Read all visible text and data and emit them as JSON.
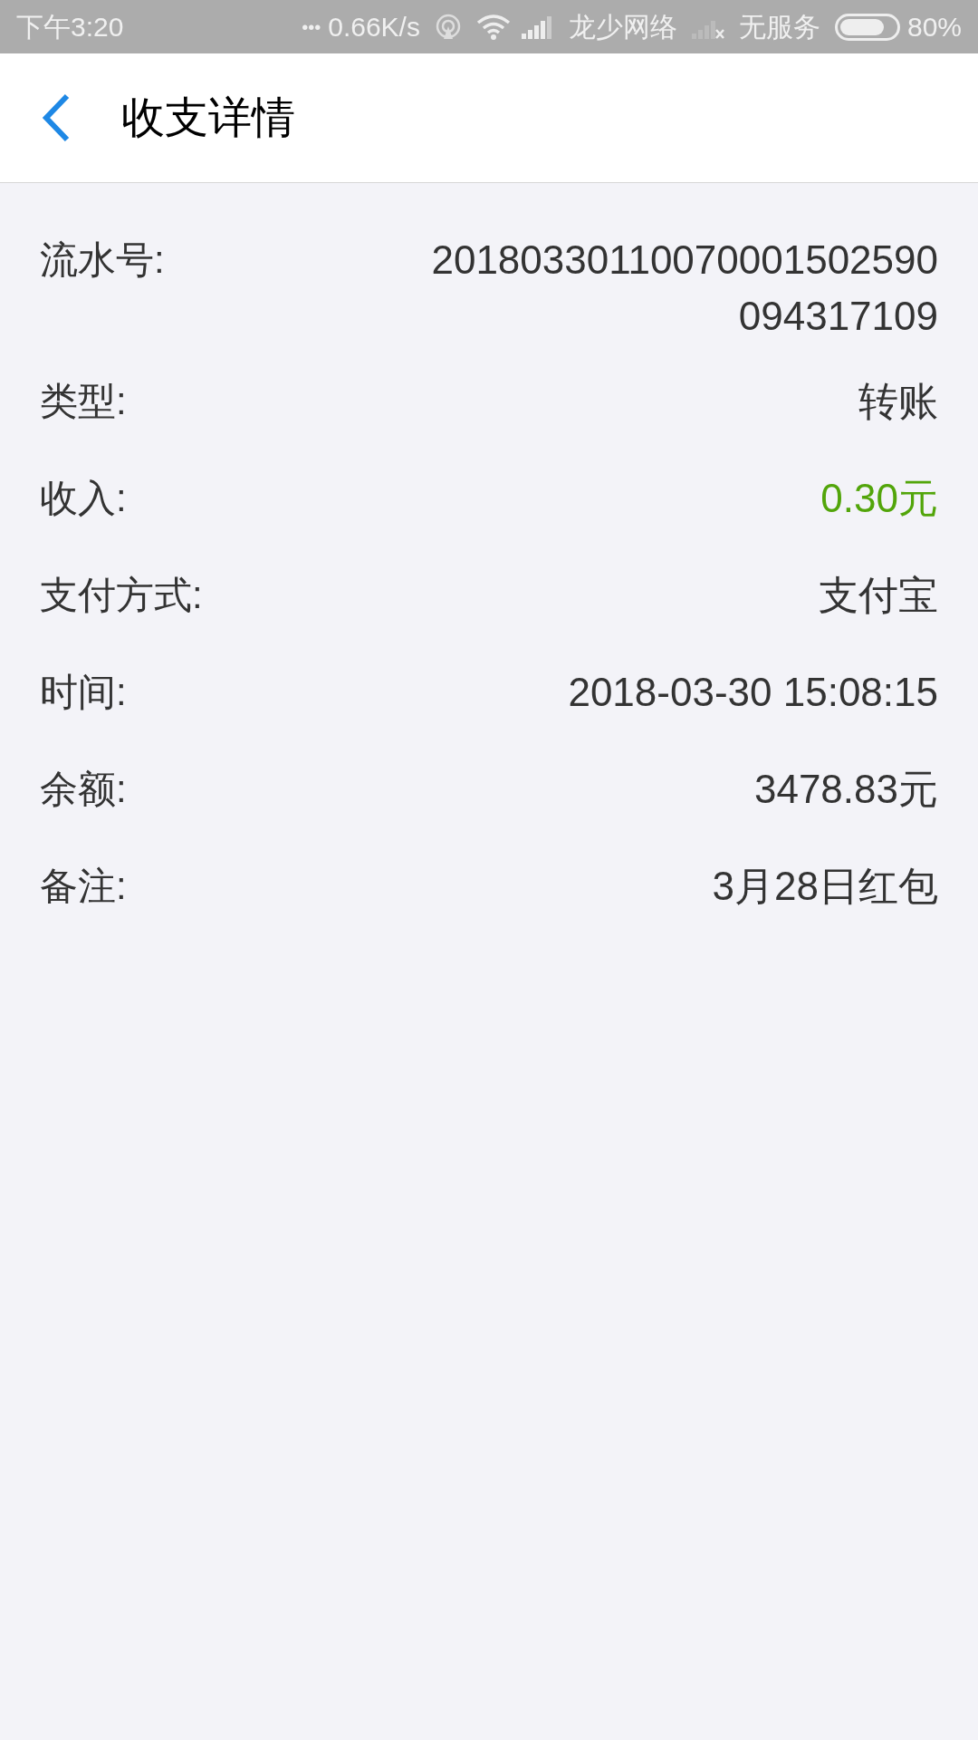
{
  "status_bar": {
    "time": "下午3:20",
    "more": "•••",
    "speed": "0.66K/s",
    "carrier": "龙少网络",
    "no_service": "无服务",
    "battery": "80%"
  },
  "header": {
    "title": "收支详情"
  },
  "details": [
    {
      "label": "流水号:",
      "value": "20180330110070001502590\n094317109",
      "kind": "plain"
    },
    {
      "label": "类型:",
      "value": "转账",
      "kind": "plain"
    },
    {
      "label": "收入:",
      "value": "0.30元",
      "kind": "income"
    },
    {
      "label": "支付方式:",
      "value": "支付宝",
      "kind": "plain"
    },
    {
      "label": "时间:",
      "value": "2018-03-30 15:08:15",
      "kind": "plain"
    },
    {
      "label": "余额:",
      "value": "3478.83元",
      "kind": "plain"
    },
    {
      "label": "备注:",
      "value": "3月28日红包",
      "kind": "plain"
    }
  ]
}
